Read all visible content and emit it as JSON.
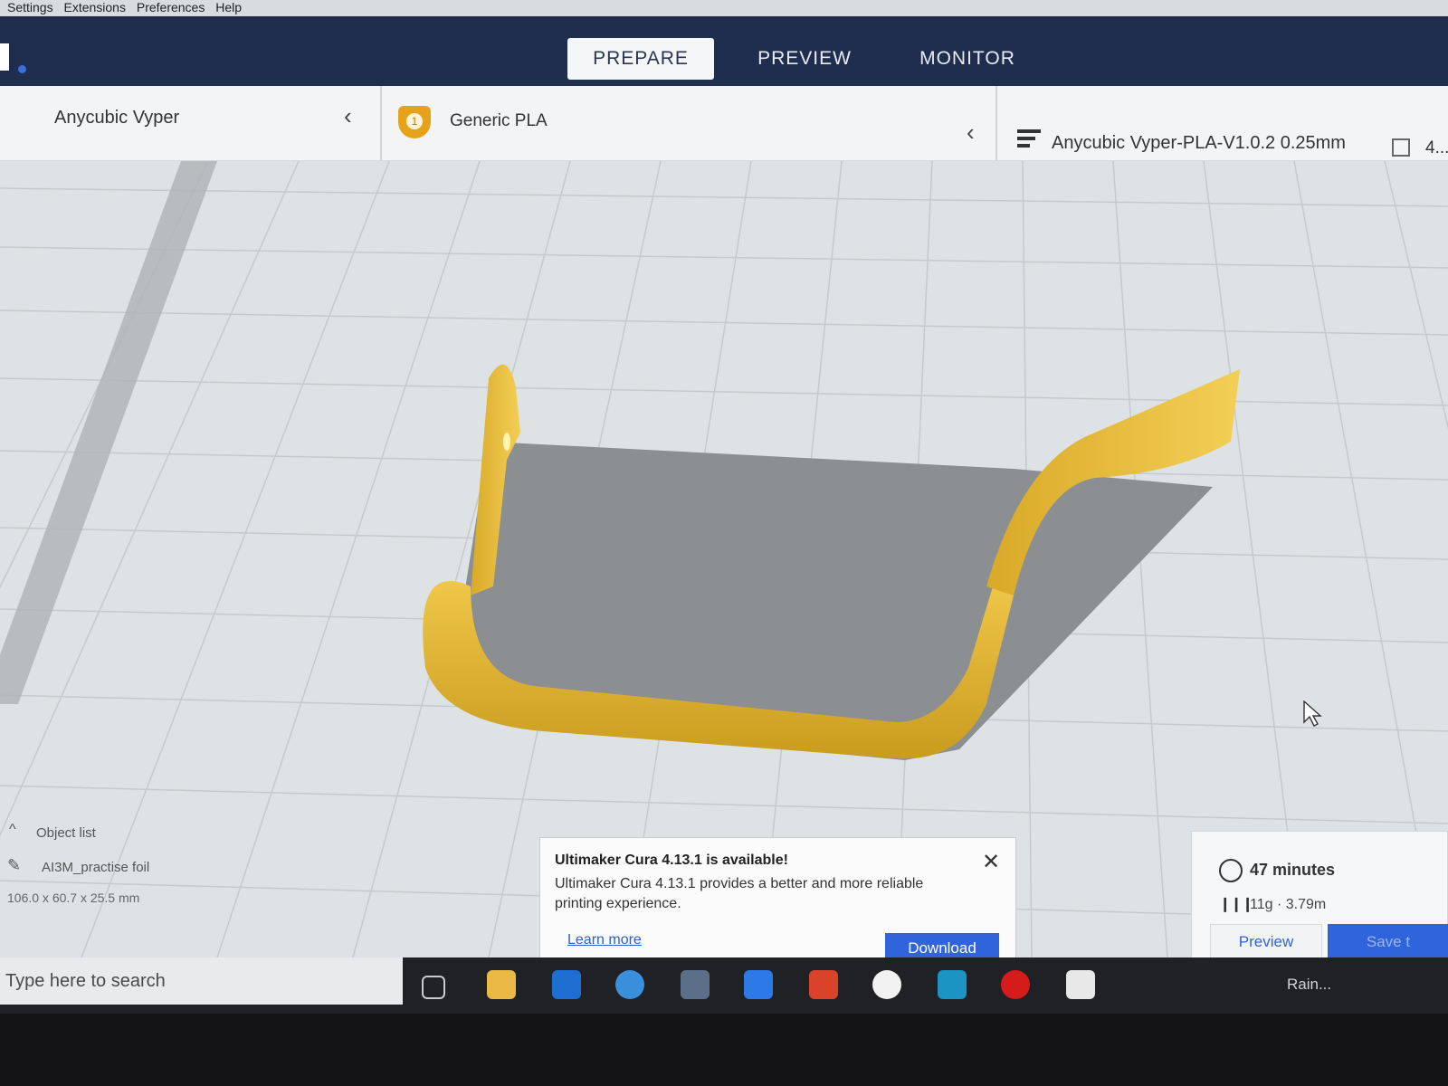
{
  "menubar": {
    "items": [
      "Settings",
      "Extensions",
      "Preferences",
      "Help"
    ]
  },
  "stages": {
    "prepare": "PREPARE",
    "preview": "PREVIEW",
    "monitor": "MONITOR"
  },
  "selectors": {
    "printer": "Anycubic Vyper",
    "extruder_number": "1",
    "material": "Generic PLA",
    "profile": "Anycubic Vyper-PLA-V1.0.2 0.25mm",
    "support": "4..."
  },
  "object_list": {
    "header": "Object list",
    "object_name": "AI3M_practise foil",
    "dimensions": "106.0 x 60.7 x 25.5 mm"
  },
  "notification": {
    "title": "Ultimaker Cura 4.13.1 is available!",
    "body": "Ultimaker Cura 4.13.1 provides a better and more reliable printing experience.",
    "link": "Learn more",
    "button": "Download"
  },
  "estimate": {
    "time": "47 minutes",
    "material": "11g · 3.79m",
    "preview_button": "Preview",
    "save_button": "Save t"
  },
  "taskbar": {
    "search_placeholder": "Type here to search",
    "weather": "Rain..."
  },
  "colors": {
    "topbar": "#1f2d4e",
    "accent": "#2f64dc",
    "model": "#e3b93c",
    "badge": "#e6a21b"
  }
}
